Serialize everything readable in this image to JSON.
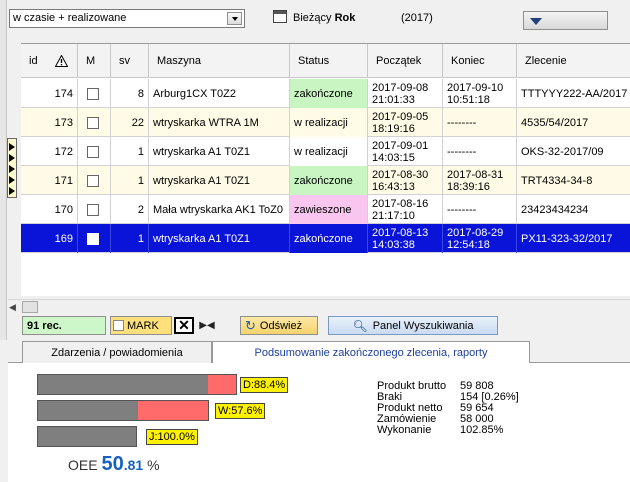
{
  "filter": {
    "mode_value": "w czasie + realizowane"
  },
  "period": {
    "label_prefix": "Bieżący",
    "label_bold": "Rok",
    "year": "(2017)"
  },
  "grid": {
    "columns": {
      "id": "id",
      "m": "M",
      "sv": "sv",
      "maszyna": "Maszyna",
      "status": "Status",
      "poczatek": "Początek",
      "koniec": "Koniec",
      "zlecenie": "Zlecenie"
    },
    "rows": [
      {
        "id": "174",
        "sv": "8",
        "maszyna": "Arburg1CX T0Z2",
        "status": "zakończone",
        "status_color": "#c8f5c2",
        "poczatek": "2017-09-08 21:01:33",
        "koniec": "2017-09-10 10:51:18",
        "zlecenie": "TTTYYY222-AA/2017",
        "row_bg": "#ffffff"
      },
      {
        "id": "173",
        "sv": "22",
        "maszyna": "wtryskarka WTRA 1M",
        "status": "w realizacji",
        "status_color": "#fffbe6",
        "poczatek": "2017-09-05 18:19:16",
        "koniec": "--------",
        "zlecenie": "4535/54/2017",
        "row_bg": "#fffbe6"
      },
      {
        "id": "172",
        "sv": "1",
        "maszyna": "wtryskarka A1  T0Z1",
        "status": "w realizacji",
        "status_color": "#ffffff",
        "poczatek": "2017-09-01 14:03:15",
        "koniec": "--------",
        "zlecenie": "OKS-32-2017/09",
        "row_bg": "#ffffff"
      },
      {
        "id": "171",
        "sv": "1",
        "maszyna": "wtryskarka A1  T0Z1",
        "status": "zakończone",
        "status_color": "#c8f5c2",
        "poczatek": "2017-08-30 16:43:13",
        "koniec": "2017-08-31 18:39:16",
        "zlecenie": "TRT4334-34-8",
        "row_bg": "#fffbe6"
      },
      {
        "id": "170",
        "sv": "2",
        "maszyna": "Mała wtryskarka AK1 ToZ0",
        "status": "zawieszone",
        "status_color": "#f9c6f0",
        "poczatek": "2017-08-16 21:17:10",
        "koniec": "--------",
        "zlecenie": "23423434234",
        "row_bg": "#ffffff"
      },
      {
        "id": "169",
        "sv": "1",
        "maszyna": "wtryskarka A1  T0Z1",
        "status": "zakończone",
        "status_color": "#0a14d8",
        "poczatek": "2017-08-13 14:03:38",
        "koniec": "2017-08-29 12:54:18",
        "zlecenie": "PX11-323-32/2017",
        "row_bg": "#0a14d8",
        "selected": true
      }
    ]
  },
  "toolbar": {
    "rec_count": "91 rec.",
    "mark_label": "MARK",
    "refresh_label": "Odśwież",
    "search_panel_label": "Panel Wyszukiwania"
  },
  "tabs": [
    {
      "label": "Zdarzenia / powiadomienia"
    },
    {
      "label": "Podsumowanie zakończonego zlecenia, raporty"
    }
  ],
  "summary": {
    "bars": [
      {
        "label": "D:88.4%",
        "fraction": 0.884
      },
      {
        "label": "W:57.6%",
        "fraction": 0.576
      },
      {
        "label": "J:100.0%",
        "fraction": 1.0
      }
    ],
    "oee_prefix": "OEE",
    "oee_int": "50",
    "oee_dec": ".81",
    "oee_unit": "%",
    "stats": [
      {
        "key": "Produkt brutto",
        "value": "59 808"
      },
      {
        "key": "Braki",
        "value": "154 [0.26%]"
      },
      {
        "key": "Produkt netto",
        "value": "59 654"
      },
      {
        "key": "Zamówienie",
        "value": "58 000"
      },
      {
        "key": "Wykonanie",
        "value": "102.85%"
      }
    ]
  }
}
